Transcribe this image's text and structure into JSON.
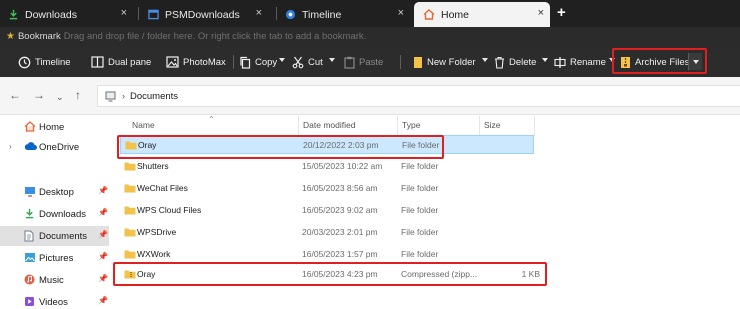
{
  "tabs": [
    {
      "label": "Downloads",
      "icon": "download-icon",
      "active": false
    },
    {
      "label": "PSMDownloads",
      "icon": "app-window-icon",
      "active": false
    },
    {
      "label": "Timeline",
      "icon": "timeline-icon",
      "active": false
    },
    {
      "label": "Home",
      "icon": "home-icon",
      "active": true
    }
  ],
  "new_tab_label": "+",
  "close_glyph": "×",
  "bookmark_bar": {
    "label": "Bookmark",
    "hint": "Drag and drop file / folder here. Or right click the tab to add a bookmark."
  },
  "toolbar": {
    "timeline": "Timeline",
    "dual_pane": "Dual pane",
    "photomax": "PhotoMax",
    "copy": "Copy",
    "cut": "Cut",
    "paste": "Paste",
    "new_folder": "New Folder",
    "delete": "Delete",
    "rename": "Rename",
    "archive_files": "Archive Files"
  },
  "address": {
    "breadcrumb_sep": "›",
    "current": "Documents"
  },
  "sidebar": {
    "items": [
      {
        "label": "Home",
        "icon": "home-icon",
        "pinned": false
      },
      {
        "label": "OneDrive",
        "icon": "cloud-icon",
        "pinned": false
      },
      {
        "label": "Desktop",
        "icon": "desktop-icon",
        "pinned": true
      },
      {
        "label": "Downloads",
        "icon": "download-icon",
        "pinned": true
      },
      {
        "label": "Documents",
        "icon": "document-icon",
        "pinned": true
      },
      {
        "label": "Pictures",
        "icon": "pictures-icon",
        "pinned": true
      },
      {
        "label": "Music",
        "icon": "music-icon",
        "pinned": true
      },
      {
        "label": "Videos",
        "icon": "video-icon",
        "pinned": true
      }
    ],
    "pin_glyph": "📌"
  },
  "columns": {
    "name": "Name",
    "date_modified": "Date modified",
    "type": "Type",
    "size": "Size"
  },
  "files": [
    {
      "name": "Oray",
      "date": "20/12/2022 2:03 pm",
      "type": "File folder",
      "size": "",
      "kind": "folder",
      "selected": true
    },
    {
      "name": "Shutters",
      "date": "15/05/2023 10:22 am",
      "type": "File folder",
      "size": "",
      "kind": "folder",
      "selected": false
    },
    {
      "name": "WeChat Files",
      "date": "16/05/2023 8:56 am",
      "type": "File folder",
      "size": "",
      "kind": "folder",
      "selected": false
    },
    {
      "name": "WPS Cloud Files",
      "date": "16/05/2023 9:02 am",
      "type": "File folder",
      "size": "",
      "kind": "folder",
      "selected": false
    },
    {
      "name": "WPSDrive",
      "date": "20/03/2023 2:01 pm",
      "type": "File folder",
      "size": "",
      "kind": "folder",
      "selected": false
    },
    {
      "name": "WXWork",
      "date": "16/05/2023 1:57 pm",
      "type": "File folder",
      "size": "",
      "kind": "folder",
      "selected": false
    },
    {
      "name": "Oray",
      "date": "16/05/2023 4:23 pm",
      "type": "Compressed (zipp...",
      "size": "1 KB",
      "kind": "zip",
      "selected": false
    }
  ],
  "colors": {
    "highlight_red": "#e02020",
    "selection_blue": "#cce8ff",
    "folder_yellow": "#f2c24b",
    "accent_blue": "#0078d4"
  }
}
